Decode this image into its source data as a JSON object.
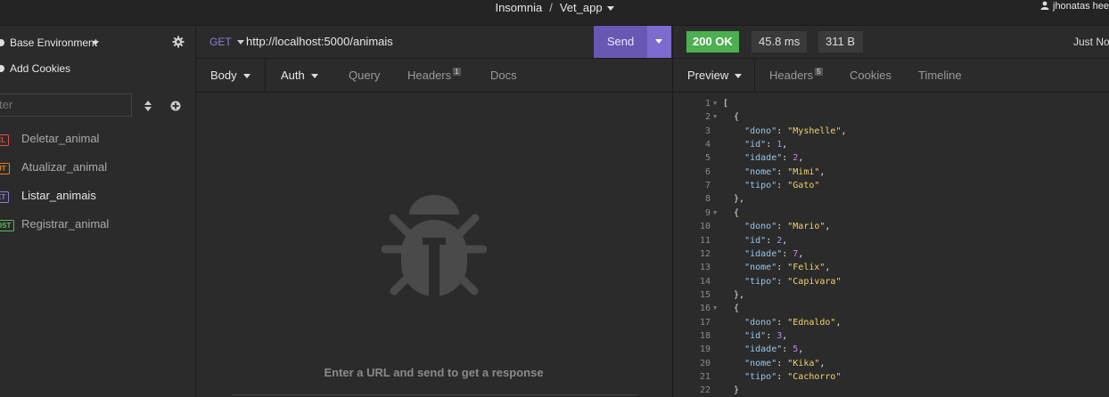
{
  "titlebar": {
    "app": "Insomnia",
    "separator": "/",
    "workspace": "Vet_app",
    "user": "jhonatas hee"
  },
  "sidebar": {
    "environment": "Base Environment",
    "cookies": "Add Cookies",
    "filter_placeholder": "ter",
    "requests": [
      {
        "method": "EL",
        "name": "Deletar_animal",
        "color": "#d9534f"
      },
      {
        "method": "UT",
        "name": "Atualizar_animal",
        "color": "#e67e22"
      },
      {
        "method": "ET",
        "name": "Listar_animais",
        "color": "#8e7cd9",
        "active": true
      },
      {
        "method": "OST",
        "name": "Registrar_animal",
        "color": "#5cb85c"
      }
    ]
  },
  "request": {
    "method": "GET",
    "url": "http://localhost:5000/animais",
    "send": "Send",
    "tabs": {
      "body": "Body",
      "auth": "Auth",
      "query": "Query",
      "headers": "Headers",
      "headers_count": "1",
      "docs": "Docs"
    },
    "empty_message": "Enter a URL and send to get a response"
  },
  "response": {
    "status": "200 OK",
    "time": "45.8 ms",
    "size": "311 B",
    "when": "Just No",
    "tabs": {
      "preview": "Preview",
      "headers": "Headers",
      "headers_count": "5",
      "cookies": "Cookies",
      "timeline": "Timeline"
    },
    "lines": [
      {
        "n": "1",
        "fold": true,
        "t": [
          [
            "p",
            "["
          ]
        ]
      },
      {
        "n": "2",
        "fold": true,
        "t": [
          [
            "p",
            "  {"
          ]
        ]
      },
      {
        "n": "3",
        "t": [
          [
            "p",
            "    "
          ],
          [
            "k",
            "\"dono\""
          ],
          [
            "p",
            ": "
          ],
          [
            "s",
            "\"Myshelle\""
          ],
          [
            "p",
            ","
          ]
        ]
      },
      {
        "n": "4",
        "t": [
          [
            "p",
            "    "
          ],
          [
            "k",
            "\"id\""
          ],
          [
            "p",
            ": "
          ],
          [
            "n",
            "1"
          ],
          [
            "p",
            ","
          ]
        ]
      },
      {
        "n": "5",
        "t": [
          [
            "p",
            "    "
          ],
          [
            "k",
            "\"idade\""
          ],
          [
            "p",
            ": "
          ],
          [
            "n",
            "2"
          ],
          [
            "p",
            ","
          ]
        ]
      },
      {
        "n": "6",
        "t": [
          [
            "p",
            "    "
          ],
          [
            "k",
            "\"nome\""
          ],
          [
            "p",
            ": "
          ],
          [
            "s",
            "\"Mimi\""
          ],
          [
            "p",
            ","
          ]
        ]
      },
      {
        "n": "7",
        "t": [
          [
            "p",
            "    "
          ],
          [
            "k",
            "\"tipo\""
          ],
          [
            "p",
            ": "
          ],
          [
            "s",
            "\"Gato\""
          ]
        ]
      },
      {
        "n": "8",
        "t": [
          [
            "p",
            "  },"
          ]
        ]
      },
      {
        "n": "9",
        "fold": true,
        "t": [
          [
            "p",
            "  {"
          ]
        ]
      },
      {
        "n": "10",
        "t": [
          [
            "p",
            "    "
          ],
          [
            "k",
            "\"dono\""
          ],
          [
            "p",
            ": "
          ],
          [
            "s",
            "\"Mario\""
          ],
          [
            "p",
            ","
          ]
        ]
      },
      {
        "n": "11",
        "t": [
          [
            "p",
            "    "
          ],
          [
            "k",
            "\"id\""
          ],
          [
            "p",
            ": "
          ],
          [
            "n",
            "2"
          ],
          [
            "p",
            ","
          ]
        ]
      },
      {
        "n": "12",
        "t": [
          [
            "p",
            "    "
          ],
          [
            "k",
            "\"idade\""
          ],
          [
            "p",
            ": "
          ],
          [
            "n",
            "7"
          ],
          [
            "p",
            ","
          ]
        ]
      },
      {
        "n": "13",
        "t": [
          [
            "p",
            "    "
          ],
          [
            "k",
            "\"nome\""
          ],
          [
            "p",
            ": "
          ],
          [
            "s",
            "\"Felix\""
          ],
          [
            "p",
            ","
          ]
        ]
      },
      {
        "n": "14",
        "t": [
          [
            "p",
            "    "
          ],
          [
            "k",
            "\"tipo\""
          ],
          [
            "p",
            ": "
          ],
          [
            "s",
            "\"Capivara\""
          ]
        ]
      },
      {
        "n": "15",
        "t": [
          [
            "p",
            "  },"
          ]
        ]
      },
      {
        "n": "16",
        "fold": true,
        "t": [
          [
            "p",
            "  {"
          ]
        ]
      },
      {
        "n": "17",
        "t": [
          [
            "p",
            "    "
          ],
          [
            "k",
            "\"dono\""
          ],
          [
            "p",
            ": "
          ],
          [
            "s",
            "\"Ednaldo\""
          ],
          [
            "p",
            ","
          ]
        ]
      },
      {
        "n": "18",
        "t": [
          [
            "p",
            "    "
          ],
          [
            "k",
            "\"id\""
          ],
          [
            "p",
            ": "
          ],
          [
            "n",
            "3"
          ],
          [
            "p",
            ","
          ]
        ]
      },
      {
        "n": "19",
        "t": [
          [
            "p",
            "    "
          ],
          [
            "k",
            "\"idade\""
          ],
          [
            "p",
            ": "
          ],
          [
            "n",
            "5"
          ],
          [
            "p",
            ","
          ]
        ]
      },
      {
        "n": "20",
        "t": [
          [
            "p",
            "    "
          ],
          [
            "k",
            "\"nome\""
          ],
          [
            "p",
            ": "
          ],
          [
            "s",
            "\"Kika\""
          ],
          [
            "p",
            ","
          ]
        ]
      },
      {
        "n": "21",
        "t": [
          [
            "p",
            "    "
          ],
          [
            "k",
            "\"tipo\""
          ],
          [
            "p",
            ": "
          ],
          [
            "s",
            "\"Cachorro\""
          ]
        ]
      },
      {
        "n": "22",
        "t": [
          [
            "p",
            "  }"
          ]
        ]
      }
    ]
  }
}
